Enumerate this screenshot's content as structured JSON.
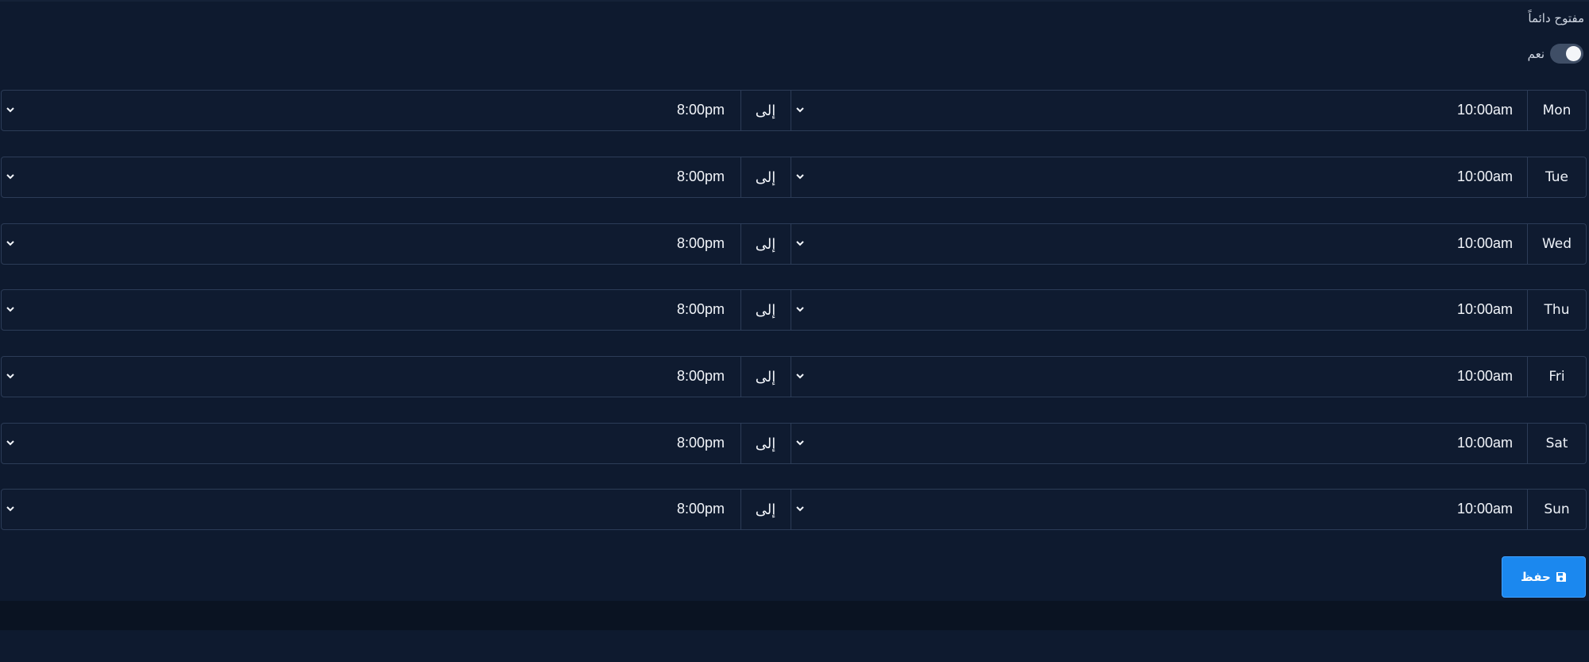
{
  "settings": {
    "always_open_label": "مفتوح دائماً",
    "toggle_label": "نعم",
    "toggle_on": true,
    "separator": "إلى",
    "save_label": "حفظ"
  },
  "schedule": [
    {
      "day": "Mon",
      "open": "10:00am",
      "close": "8:00pm"
    },
    {
      "day": "Tue",
      "open": "10:00am",
      "close": "8:00pm"
    },
    {
      "day": "Wed",
      "open": "10:00am",
      "close": "8:00pm"
    },
    {
      "day": "Thu",
      "open": "10:00am",
      "close": "8:00pm"
    },
    {
      "day": "Fri",
      "open": "10:00am",
      "close": "8:00pm"
    },
    {
      "day": "Sat",
      "open": "10:00am",
      "close": "8:00pm"
    },
    {
      "day": "Sun",
      "open": "10:00am",
      "close": "8:00pm"
    }
  ],
  "colors": {
    "background": "#0e1a2f",
    "border": "#2c3c57",
    "accent": "#1b88ef",
    "toggle_track": "#3f4e66"
  },
  "icons": {
    "dropdown": "chevron-down-icon",
    "save": "floppy-disk-icon"
  }
}
